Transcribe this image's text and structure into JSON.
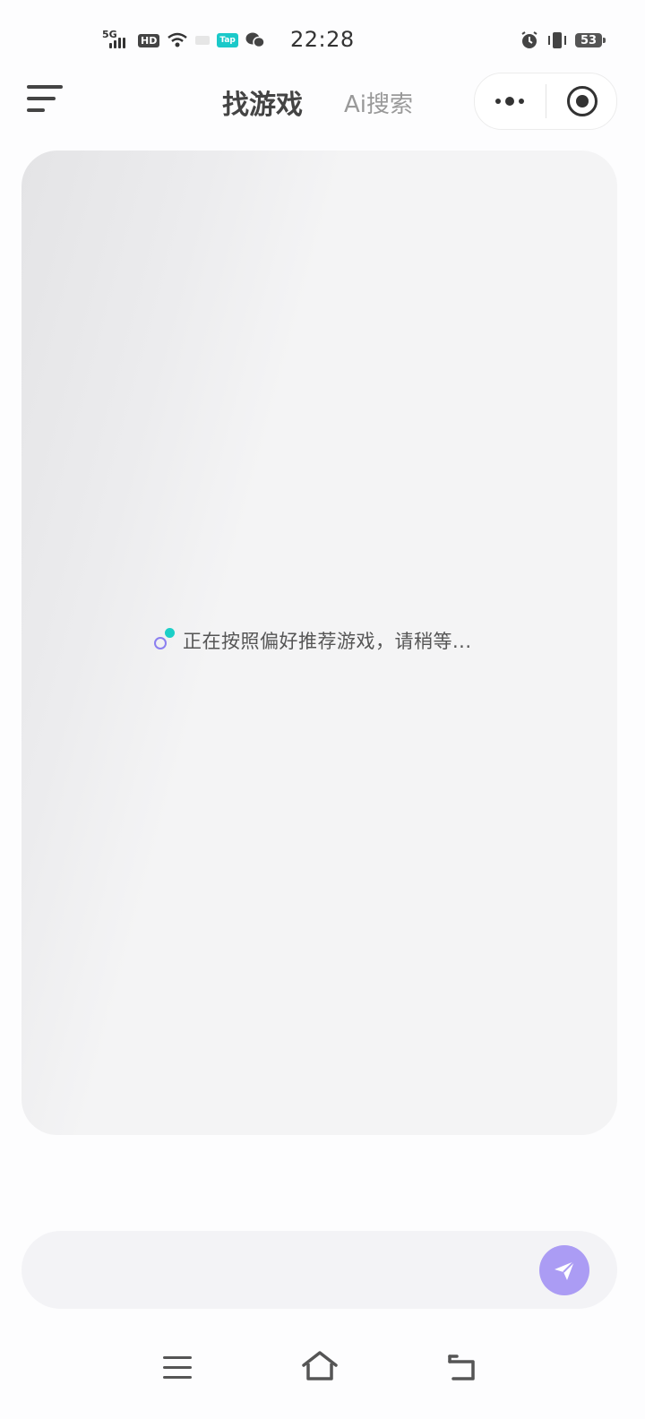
{
  "status_bar": {
    "network": "5G",
    "hd": "HD",
    "tap_badge": "Tap",
    "time": "22:28",
    "battery": "53"
  },
  "header": {
    "tabs": [
      {
        "label": "找游戏",
        "active": true
      },
      {
        "label": "Ai搜索",
        "active": false
      }
    ]
  },
  "main": {
    "loading_text": "正在按照偏好推荐游戏，请稍等..."
  },
  "input": {
    "value": "",
    "placeholder": ""
  },
  "colors": {
    "accent": "#ab9cf4",
    "spinner_teal": "#1ccfc7",
    "spinner_purple": "#8b7ff0",
    "tap_badge": "#1bc9c9"
  },
  "icons": {
    "menu": "menu-icon",
    "more": "more-dots-icon",
    "close": "target-close-icon",
    "send": "paper-plane-icon",
    "nav_menu": "nav-menu-icon",
    "nav_home": "home-icon",
    "nav_back": "back-icon"
  }
}
